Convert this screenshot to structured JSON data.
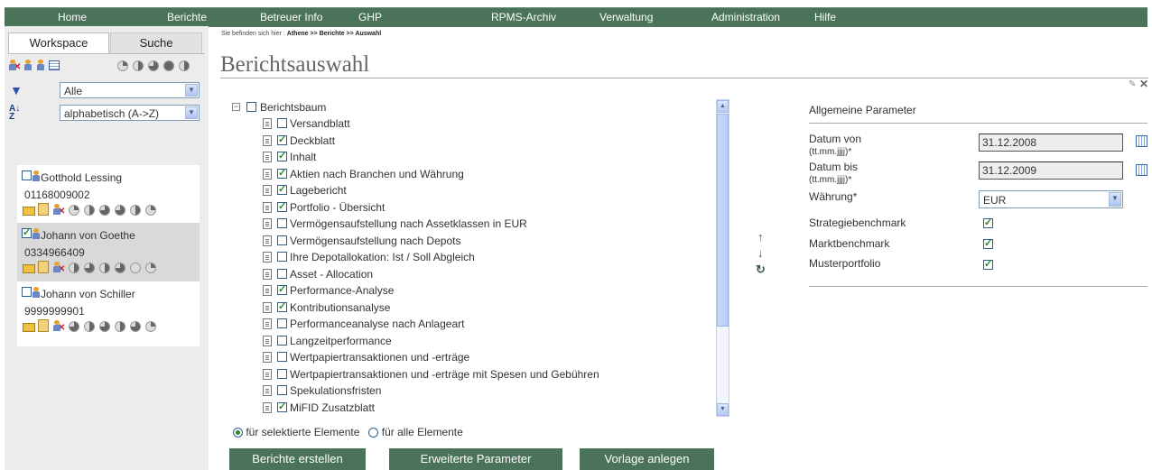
{
  "nav": [
    "Home",
    "Berichte",
    "Betreuer Info",
    "GHP",
    "RPMS-Archiv",
    "Verwaltung",
    "Administration",
    "Hilfe"
  ],
  "sidebar": {
    "tabs": [
      "Workspace",
      "Suche"
    ],
    "filter_value": "Alle",
    "sort_value": "alphabetisch (A->Z)",
    "clients": [
      {
        "name": "Gotthold Lessing",
        "number": "01168009002",
        "checked": false
      },
      {
        "name": "Johann von Goethe",
        "number": "0334966409",
        "checked": true
      },
      {
        "name": "Johann von Schiller",
        "number": "9999999901",
        "checked": false
      }
    ]
  },
  "breadcrumb": {
    "prefix": "Sie befinden sich hier :",
    "path": "Athene  >>  Berichte  >>  Auswahl"
  },
  "page_title": "Berichtsauswahl",
  "tree": {
    "root": "Berichtsbaum",
    "items": [
      {
        "label": "Versandblatt",
        "checked": false
      },
      {
        "label": "Deckblatt",
        "checked": true
      },
      {
        "label": "Inhalt",
        "checked": true
      },
      {
        "label": "Aktien nach Branchen und Währung",
        "checked": true
      },
      {
        "label": "Lagebericht",
        "checked": true
      },
      {
        "label": "Portfolio - Übersicht",
        "checked": true
      },
      {
        "label": "Vermögensaufstellung nach Assetklassen in EUR",
        "checked": false
      },
      {
        "label": "Vermögensaufstellung nach Depots",
        "checked": false
      },
      {
        "label": "Ihre Depotallokation: Ist / Soll Abgleich",
        "checked": false
      },
      {
        "label": "Asset - Allocation",
        "checked": false
      },
      {
        "label": "Performance-Analyse",
        "checked": true
      },
      {
        "label": "Kontributionsanalyse",
        "checked": true
      },
      {
        "label": "Performanceanalyse nach Anlageart",
        "checked": false
      },
      {
        "label": "Langzeitperformance",
        "checked": false
      },
      {
        "label": "Wertpapiertransaktionen und -erträge",
        "checked": false
      },
      {
        "label": "Wertpapiertransaktionen und -erträge mit Spesen und Gebühren",
        "checked": false
      },
      {
        "label": "Spekulationsfristen",
        "checked": false
      },
      {
        "label": "MiFID Zusatzblatt",
        "checked": true
      }
    ]
  },
  "radio": {
    "selected_label": "für selektierte Elemente",
    "all_label": "für alle Elemente"
  },
  "buttons": {
    "create": "Berichte erstellen",
    "extended": "Erweiterte Parameter",
    "template": "Vorlage anlegen"
  },
  "params": {
    "title": "Allgemeine Parameter",
    "date_from_label": "Datum von",
    "date_from_hint": "(tt.mm.jjjj)*",
    "date_from_value": "31.12.2008",
    "date_to_label": "Datum bis",
    "date_to_hint": "(tt.mm.jjjj)*",
    "date_to_value": "31.12.2009",
    "currency_label": "Währung*",
    "currency_value": "EUR",
    "strategy_label": "Strategiebenchmark",
    "market_label": "Marktbenchmark",
    "model_label": "Musterportfolio"
  },
  "colors": {
    "nav": "#4a7359",
    "button": "#4a7359",
    "sidebar": "#ececec"
  }
}
